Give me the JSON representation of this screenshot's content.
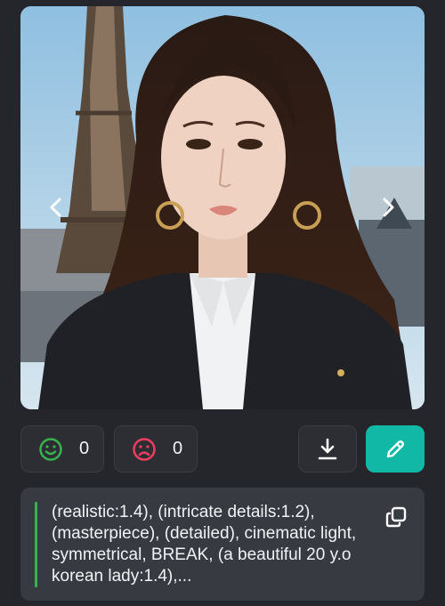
{
  "image": {
    "alt_icon": "portrait-image"
  },
  "reactions": {
    "like_count": "0",
    "dislike_count": "0"
  },
  "prompt": {
    "text": "(realistic:1.4), (intricate details:1.2), (masterpiece), (detailed), cinematic light, symmetrical, BREAK, (a beautiful 20 y.o korean lady:1.4),..."
  },
  "colors": {
    "background": "#25262b",
    "button_bg": "#2c2e33",
    "prompt_bg": "#373a40",
    "accent_teal": "#12b8a6",
    "like_green": "#37b24d",
    "dislike_red": "#f03e3e"
  },
  "icons": {
    "prev": "chevron-left-icon",
    "next": "chevron-right-icon",
    "like": "smile-icon",
    "dislike": "frown-icon",
    "download": "download-icon",
    "edit": "pencil-icon",
    "copy": "copy-icon"
  }
}
